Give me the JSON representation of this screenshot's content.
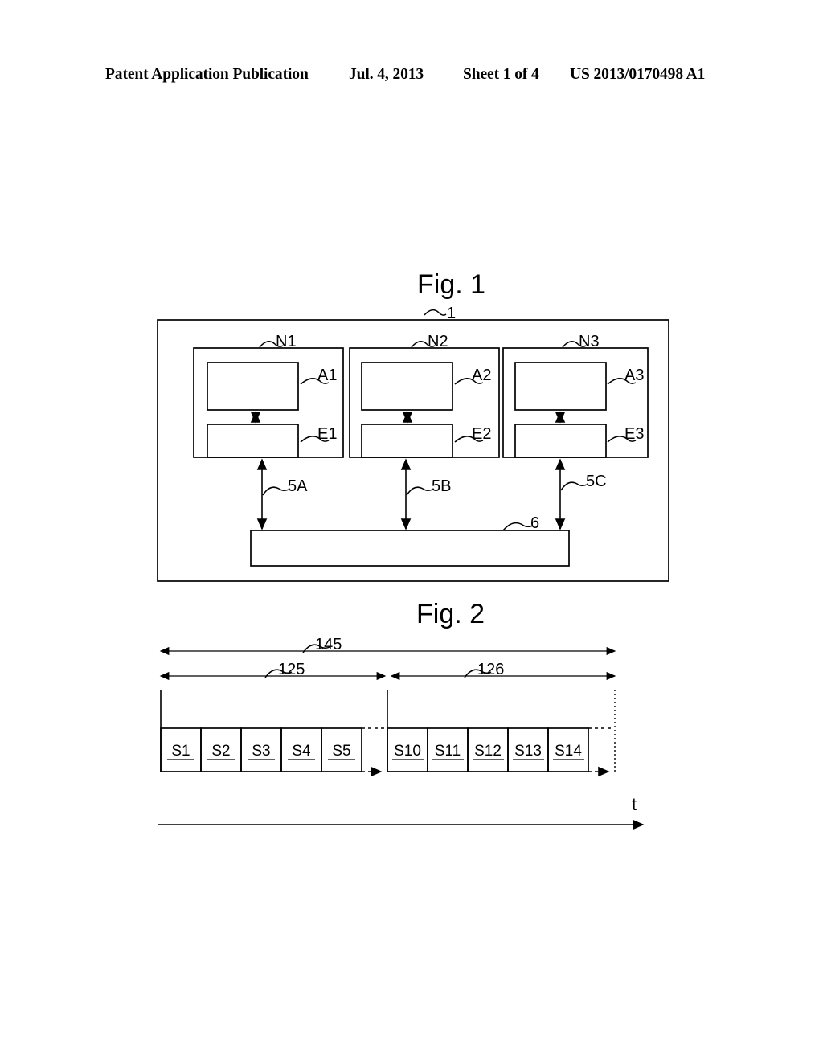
{
  "header": {
    "publication": "Patent Application Publication",
    "date": "Jul. 4, 2013",
    "sheet": "Sheet 1 of 4",
    "patent_number": "US 2013/0170498 A1"
  },
  "figures": [
    {
      "title": "Fig. 1",
      "outer_ref": "1",
      "nodes": [
        {
          "node_ref": "N1",
          "upper_ref": "A1",
          "lower_ref": "E1",
          "bus_link_ref": "5A"
        },
        {
          "node_ref": "N2",
          "upper_ref": "A2",
          "lower_ref": "E2",
          "bus_link_ref": "5B"
        },
        {
          "node_ref": "N3",
          "upper_ref": "A3",
          "lower_ref": "E3",
          "bus_link_ref": "5C"
        }
      ],
      "bus_ref": "6"
    },
    {
      "title": "Fig. 2",
      "spans": [
        {
          "ref": "145"
        },
        {
          "ref": "125"
        },
        {
          "ref": "126"
        }
      ],
      "slot_groups": [
        {
          "slots": [
            "S1",
            "S2",
            "S3",
            "S4",
            "S5"
          ]
        },
        {
          "slots": [
            "S10",
            "S11",
            "S12",
            "S13",
            "S14"
          ]
        }
      ],
      "time_axis_label": "t"
    }
  ],
  "colors": {
    "ink": "#000000",
    "paper": "#ffffff"
  }
}
